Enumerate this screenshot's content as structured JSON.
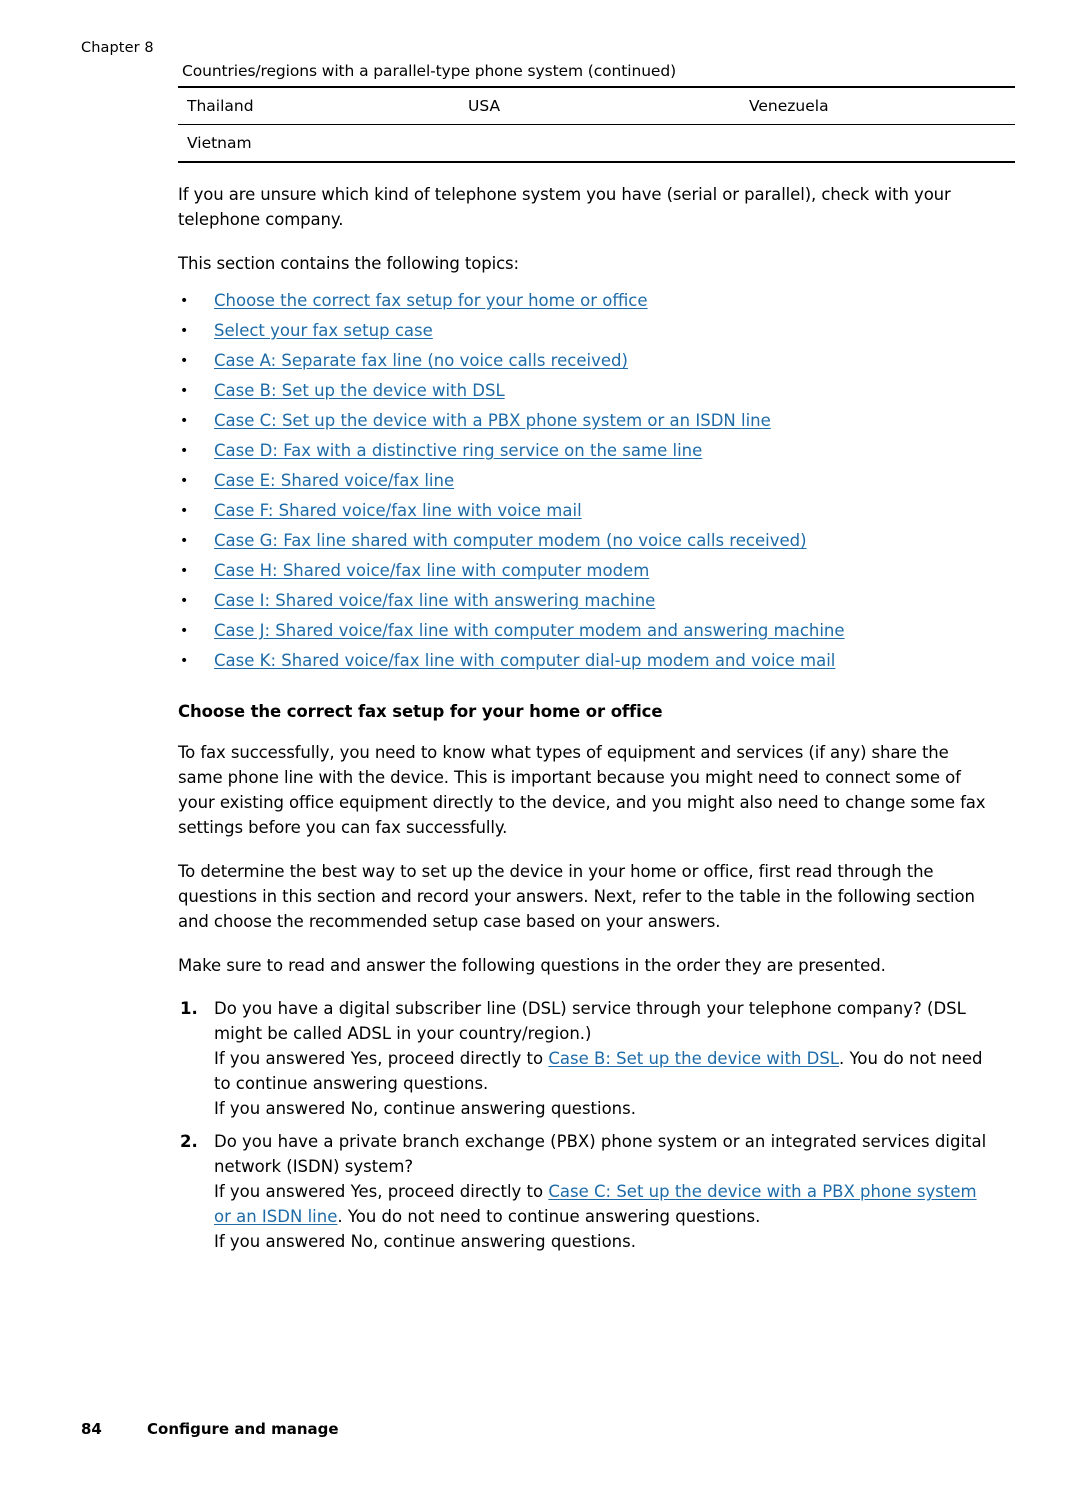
{
  "header": {
    "chapter": "Chapter 8"
  },
  "table": {
    "caption": "Countries/regions with a parallel-type phone system (continued)",
    "rows": [
      [
        "Thailand",
        "USA",
        "Venezuela"
      ],
      [
        "Vietnam",
        "",
        ""
      ]
    ]
  },
  "paragraphs": {
    "p1": "If you are unsure which kind of telephone system you have (serial or parallel), check with your telephone company.",
    "p2": "This section contains the following topics:"
  },
  "toc": [
    "Choose the correct fax setup for your home or office",
    "Select your fax setup case",
    "Case A: Separate fax line (no voice calls received)",
    "Case B: Set up the device with DSL",
    "Case C: Set up the device with a PBX phone system or an ISDN line",
    "Case D: Fax with a distinctive ring service on the same line",
    "Case E: Shared voice/fax line",
    "Case F: Shared voice/fax line with voice mail",
    "Case G: Fax line shared with computer modem (no voice calls received)",
    "Case H: Shared voice/fax line with computer modem",
    "Case I: Shared voice/fax line with answering machine",
    "Case J: Shared voice/fax line with computer modem and answering machine",
    "Case K: Shared voice/fax line with computer dial-up modem and voice mail"
  ],
  "section": {
    "heading": "Choose the correct fax setup for your home or office",
    "p1": "To fax successfully, you need to know what types of equipment and services (if any) share the same phone line with the device. This is important because you might need to connect some of your existing office equipment directly to the device, and you might also need to change some fax settings before you can fax successfully.",
    "p2": "To determine the best way to set up the device in your home or office, first read through the questions in this section and record your answers. Next, refer to the table in the following section and choose the recommended setup case based on your answers.",
    "p3": "Make sure to read and answer the following questions in the order they are presented."
  },
  "questions": [
    {
      "text": "Do you have a digital subscriber line (DSL) service through your telephone company? (DSL might be called ADSL in your country/region.)",
      "yes_prefix": "If you answered Yes, proceed directly to ",
      "yes_link": "Case B: Set up the device with DSL",
      "yes_suffix": ". You do not need to continue answering questions.",
      "no_text": "If you answered No, continue answering questions."
    },
    {
      "text": "Do you have a private branch exchange (PBX) phone system or an integrated services digital network (ISDN) system?",
      "yes_prefix": "If you answered Yes, proceed directly to ",
      "yes_link": "Case C: Set up the device with a PBX phone system or an ISDN line",
      "yes_suffix": ". You do not need to continue answering questions.",
      "no_text": "If you answered No, continue answering questions."
    }
  ],
  "footer": {
    "page_number": "84",
    "label": "Configure and manage"
  },
  "colors": {
    "link": "#1e6ba8",
    "text": "#000000",
    "background": "#ffffff"
  }
}
